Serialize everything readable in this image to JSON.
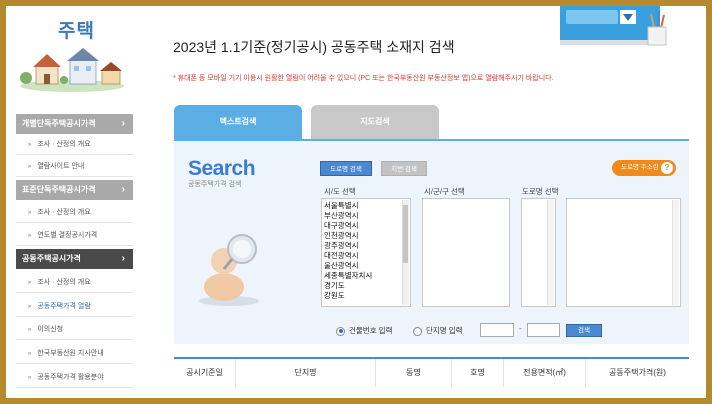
{
  "sidebar": {
    "title": "주택",
    "groups": [
      {
        "label": "개별단독주택공시가격",
        "items": [
          "조사 · 산정의 개요",
          "열람사이트 안내"
        ]
      },
      {
        "label": "표준단독주택공시가격",
        "items": [
          "조사 · 산정의 개요",
          "연도별 결정공시가격"
        ]
      },
      {
        "label": "공동주택공시가격",
        "items": [
          "조사 · 산정의 개요",
          "공동주택가격 열람",
          "이의신청",
          "한국부동산원 지사안내",
          "공동주택가격 활용분야"
        ]
      }
    ],
    "chevron": "›"
  },
  "page": {
    "title": "2023년 1.1기준(정기공시) 공동주택 소재지 검색",
    "notice": "* 휴대폰 등 모바일 기기 이용시 원활한 열람이 어려울 수 있으니 (PC 또는 한국부동산원 부동산정보 앱)으로 열람해주시기 바랍니다."
  },
  "tabs": {
    "text_search": "텍스트검색",
    "map_search": "지도검색"
  },
  "search": {
    "word": "Search",
    "sub": "공동주택가격 검색",
    "mode_road": "도로명 검색",
    "mode_lot": "지번 검색",
    "help": "도로명 주소란",
    "help_icon": "?",
    "label_sido": "시/도 선택",
    "label_sigungu": "시/군/구 선택",
    "label_road": "도로명 선택",
    "sido_options": [
      "서울특별시",
      "부산광역시",
      "대구광역시",
      "인천광역시",
      "광주광역시",
      "대전광역시",
      "울산광역시",
      "세종특별자치시",
      "경기도",
      "강원도"
    ],
    "radio_building": "건물번호 입력",
    "radio_complex": "단지명 입력",
    "dash": "-",
    "search_button": "검색"
  },
  "table": {
    "headers": [
      "공시기준일",
      "단지명",
      "동명",
      "호명",
      "전용면적(㎡)",
      "공동주택가격(원)"
    ]
  },
  "colors": {
    "accent": "#4a89d0",
    "tab_active": "#5aaee4",
    "notice": "#d63a2a",
    "sidebar_active": "#4a4a4a",
    "frame": "#b58a2c"
  }
}
